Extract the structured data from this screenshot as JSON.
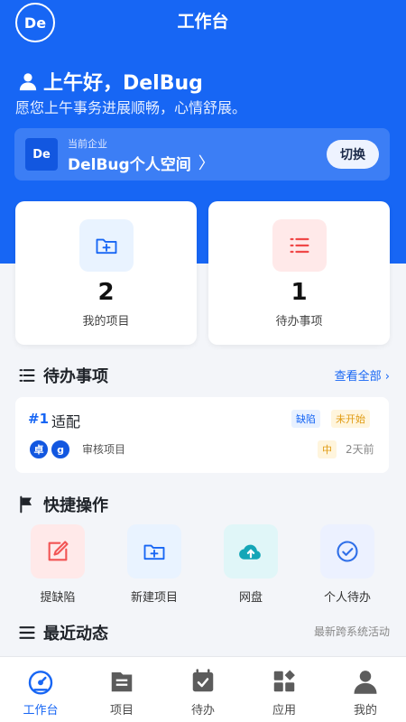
{
  "header": {
    "avatar_text": "De",
    "title": "工作台"
  },
  "greeting": {
    "title": "上午好，DelBug",
    "subtitle": "愿您上午事务进展顺畅，心情舒展。"
  },
  "enterprise": {
    "logo_text": "De",
    "label": "当前企业",
    "name": "DelBug个人空间",
    "chevron": "〉",
    "switch_label": "切换"
  },
  "stats": [
    {
      "value": "2",
      "label": "我的项目",
      "icon": "folder-plus-icon"
    },
    {
      "value": "1",
      "label": "待办事项",
      "icon": "list-icon"
    }
  ],
  "todo_section": {
    "title": "待办事项",
    "view_all": "查看全部 ›"
  },
  "todo_item": {
    "id": "#1",
    "title": "适配",
    "type_badge": "缺陷",
    "status_badge": "未开始",
    "assignees": [
      "卓",
      "g"
    ],
    "project": "审核项目",
    "priority": "中",
    "time": "2天前"
  },
  "quick_section": {
    "title": "快捷操作",
    "items": [
      {
        "label": "提缺陷",
        "icon": "edit-icon",
        "color": "#f25454"
      },
      {
        "label": "新建项目",
        "icon": "folder-plus-icon",
        "color": "#1766f4"
      },
      {
        "label": "网盘",
        "icon": "cloud-upload-icon",
        "color": "#14a6b7"
      },
      {
        "label": "个人待办",
        "icon": "check-circle-icon",
        "color": "#2f6fe8"
      }
    ]
  },
  "recent_section": {
    "title": "最近动态",
    "note": "最新跨系统活动"
  },
  "tabbar": {
    "items": [
      {
        "label": "工作台",
        "icon": "dashboard-icon",
        "active": true
      },
      {
        "label": "项目",
        "icon": "project-icon",
        "active": false
      },
      {
        "label": "待办",
        "icon": "calendar-check-icon",
        "active": false
      },
      {
        "label": "应用",
        "icon": "apps-icon",
        "active": false
      },
      {
        "label": "我的",
        "icon": "user-icon",
        "active": false
      }
    ]
  },
  "colors": {
    "primary": "#1766f4",
    "background": "#f3f5f9",
    "warning": "#e09b12"
  }
}
